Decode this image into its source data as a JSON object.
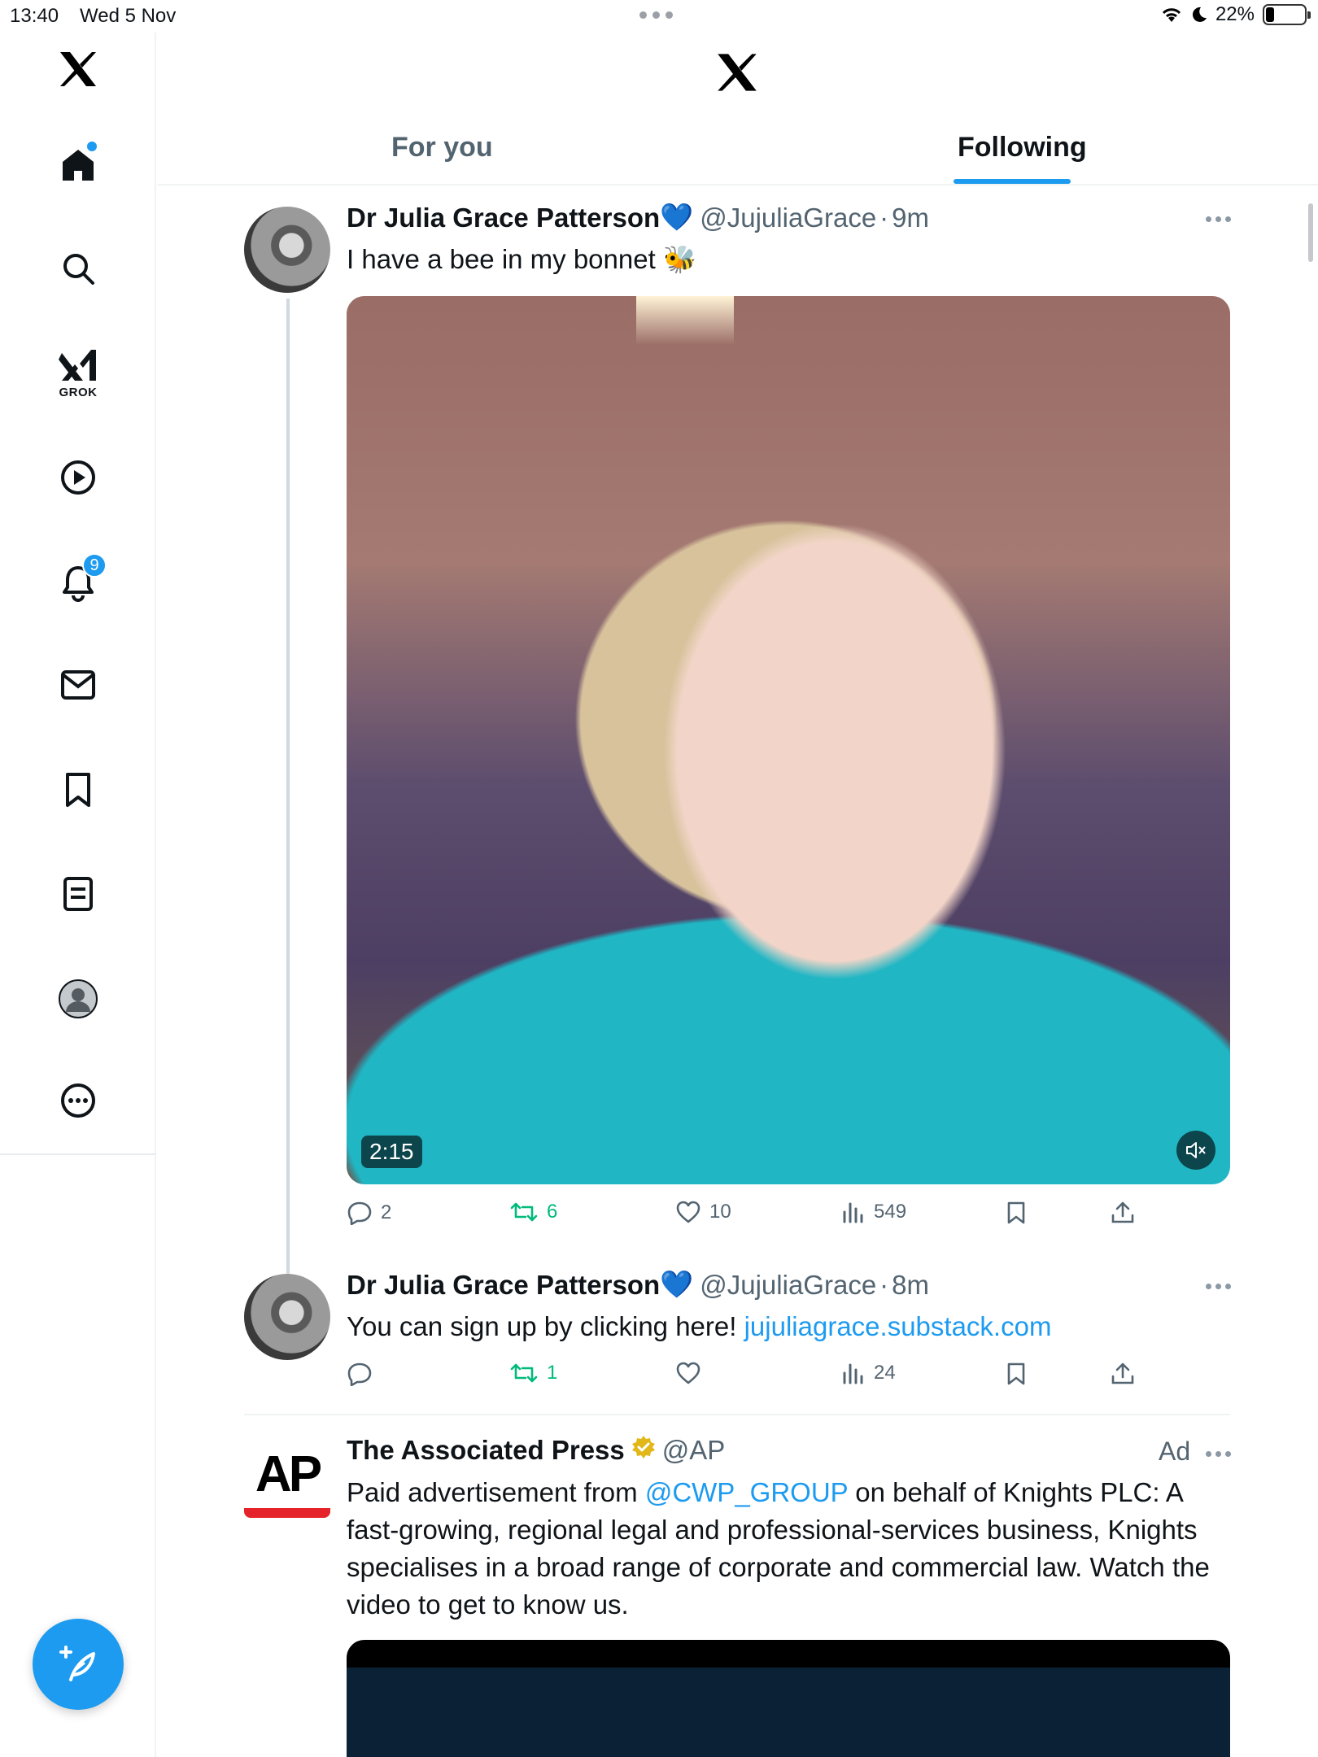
{
  "status_bar": {
    "time": "13:40",
    "date": "Wed 5 Nov",
    "battery": "22%",
    "battery_level": 0.22
  },
  "sidebar": {
    "items": [
      {
        "icon": "x-logo-icon"
      },
      {
        "icon": "home-icon",
        "unread_dot": true
      },
      {
        "icon": "search-icon"
      },
      {
        "icon": "grok-icon",
        "label": "GROK"
      },
      {
        "icon": "video-play-icon"
      },
      {
        "icon": "bell-icon",
        "badge": "9"
      },
      {
        "icon": "mail-icon"
      },
      {
        "icon": "bookmark-icon"
      },
      {
        "icon": "lists-icon"
      },
      {
        "icon": "profile-icon"
      },
      {
        "icon": "more-icon"
      }
    ],
    "compose_icon": "compose-feather-icon"
  },
  "header": {
    "tabs": [
      {
        "label": "For you",
        "active": false
      },
      {
        "label": "Following",
        "active": true
      }
    ]
  },
  "tweets": [
    {
      "name": "Dr Julia Grace Patterson",
      "emoji": "💙",
      "handle": "@JujuliaGrace",
      "sep": "·",
      "time": "9m",
      "text": "I have a bee in my bonnet",
      "text_emoji": "🐝",
      "video_duration": "2:15",
      "replies": "2",
      "reposts": "6",
      "likes": "10",
      "views": "549"
    },
    {
      "name": "Dr Julia Grace Patterson",
      "emoji": "💙",
      "handle": "@JujuliaGrace",
      "sep": "·",
      "time": "8m",
      "text": "You can sign up by clicking here!",
      "link": "jujuliagrace.substack.com",
      "replies": "",
      "reposts": "1",
      "likes": "",
      "views": "24"
    },
    {
      "name": "The Associated Press",
      "handle": "@AP",
      "ad_label": "Ad",
      "logo_text": "AP",
      "text_prefix": "Paid advertisement from ",
      "mention": "@CWP_GROUP",
      "text_rest": " on behalf of Knights PLC: A fast-growing, regional legal and professional-services business, Knights specialises in a broad range of corporate and commercial law. Watch the video to get to know us."
    }
  ],
  "colors": {
    "accent": "#1d9bf0",
    "repost_green": "#00ba7c",
    "secondary_text": "#536471",
    "ap_red": "#e4232a"
  }
}
